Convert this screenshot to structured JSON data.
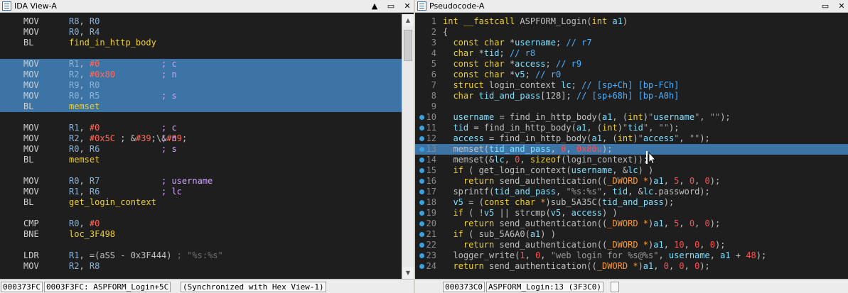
{
  "left_pane": {
    "title": "IDA View-A",
    "lines": [
      {
        "mn": "MOV",
        "op": "R8, R0",
        "cm": "",
        "hl": false
      },
      {
        "mn": "MOV",
        "op": "R0, R4",
        "cm": "",
        "hl": false
      },
      {
        "mn": "BL",
        "op": "find_in_http_body",
        "cm": "",
        "hl": false,
        "sym": true
      },
      {
        "mn": "",
        "op": "",
        "cm": "",
        "hl": false
      },
      {
        "mn": "MOV",
        "op": "R1, #0",
        "cm": "; c",
        "hl": true
      },
      {
        "mn": "MOV",
        "op": "R2, #0x80",
        "cm": "; n",
        "hl": true
      },
      {
        "mn": "MOV",
        "op": "R9, R0",
        "cm": "",
        "hl": true
      },
      {
        "mn": "MOV",
        "op": "R0, R5",
        "cm": "; s",
        "hl": true
      },
      {
        "mn": "BL",
        "op": "memset",
        "cm": "",
        "hl": true,
        "sym": true
      },
      {
        "mn": "",
        "op": "",
        "cm": "",
        "hl": false
      },
      {
        "mn": "MOV",
        "op": "R1, #0",
        "cm": "; c",
        "hl": false
      },
      {
        "mn": "MOV",
        "op": "R2, #0x5C ; '\\'",
        "cm": "; n",
        "hl": false
      },
      {
        "mn": "MOV",
        "op": "R0, R6",
        "cm": "; s",
        "hl": false
      },
      {
        "mn": "BL",
        "op": "memset",
        "cm": "",
        "hl": false,
        "sym": true
      },
      {
        "mn": "",
        "op": "",
        "cm": "",
        "hl": false
      },
      {
        "mn": "MOV",
        "op": "R0, R7",
        "cm": "; username",
        "hl": false
      },
      {
        "mn": "MOV",
        "op": "R1, R6",
        "cm": "; lc",
        "hl": false
      },
      {
        "mn": "BL",
        "op": "get_login_context",
        "cm": "",
        "hl": false,
        "sym": true
      },
      {
        "mn": "",
        "op": "",
        "cm": "",
        "hl": false
      },
      {
        "mn": "CMP",
        "op": "R0, #0",
        "cm": "",
        "hl": false
      },
      {
        "mn": "BNE",
        "op": "loc_3F498",
        "cm": "",
        "hl": false,
        "sym": true
      },
      {
        "mn": "",
        "op": "",
        "cm": "",
        "hl": false
      },
      {
        "mn": "LDR",
        "op": "R1, =(aSS - 0x3F444) ; \"%s:%s\"",
        "cm": "",
        "hl": false
      },
      {
        "mn": "MOV",
        "op": "R2, R8",
        "cm": "",
        "hl": false
      }
    ],
    "status": [
      "000373FC",
      "0003F3FC: ASPFORM_Login+5C",
      "(Synchronized with Hex View-1)"
    ]
  },
  "right_pane": {
    "title": "Pseudocode-A",
    "lines": [
      {
        "n": "1",
        "t": "int __fastcall ASPFORM_Login(int a1)",
        "dot": false
      },
      {
        "n": "2",
        "t": "{",
        "dot": false
      },
      {
        "n": "3",
        "t": "  const char *username; // r7",
        "dot": false
      },
      {
        "n": "4",
        "t": "  char *tid; // r8",
        "dot": false
      },
      {
        "n": "5",
        "t": "  const char *access; // r9",
        "dot": false
      },
      {
        "n": "6",
        "t": "  const char *v5; // r0",
        "dot": false
      },
      {
        "n": "7",
        "t": "  struct login_context lc; // [sp+Ch] [bp-FCh]",
        "dot": false
      },
      {
        "n": "8",
        "t": "  char tid_and_pass[128]; // [sp+68h] [bp-A0h]",
        "dot": false
      },
      {
        "n": "9",
        "t": "",
        "dot": false
      },
      {
        "n": "10",
        "t": "  username = find_in_http_body(a1, (int)\"username\", \"\");",
        "dot": true
      },
      {
        "n": "11",
        "t": "  tid = find_in_http_body(a1, (int)\"tid\", \"\");",
        "dot": true
      },
      {
        "n": "12",
        "t": "  access = find_in_http_body(a1, (int)\"access\", \"\");",
        "dot": true
      },
      {
        "n": "13",
        "t": "  memset(tid_and_pass, 0, 0x80u);",
        "dot": true,
        "hl": true
      },
      {
        "n": "14",
        "t": "  memset(&lc, 0, sizeof(login_context));",
        "dot": true
      },
      {
        "n": "15",
        "t": "  if ( get_login_context(username, &lc) )",
        "dot": true
      },
      {
        "n": "16",
        "t": "    return send_authentication((_DWORD *)a1, 5, 0, 0);",
        "dot": true
      },
      {
        "n": "17",
        "t": "  sprintf(tid_and_pass, \"%s:%s\", tid, &lc.password);",
        "dot": true
      },
      {
        "n": "18",
        "t": "  v5 = (const char *)sub_5A35C(tid_and_pass);",
        "dot": true
      },
      {
        "n": "19",
        "t": "  if ( !v5 || strcmp(v5, access) )",
        "dot": true
      },
      {
        "n": "20",
        "t": "    return send_authentication((_DWORD *)a1, 5, 0, 0);",
        "dot": true
      },
      {
        "n": "21",
        "t": "  if ( sub_5A6A0(a1) )",
        "dot": true
      },
      {
        "n": "22",
        "t": "    return send_authentication((_DWORD *)a1, 10, 0, 0);",
        "dot": true
      },
      {
        "n": "23",
        "t": "  logger_write(1, 0, \"web login for %s@%s\", username, a1 + 48);",
        "dot": true
      },
      {
        "n": "24",
        "t": "  return send_authentication((_DWORD *)a1, 0, 0, 0);",
        "dot": true
      }
    ],
    "status": [
      "000373C0",
      "ASPFORM_Login:13 (3F3C0)",
      ""
    ]
  },
  "window_buttons": {
    "pin": "▲",
    "float": "▭",
    "close": "✕"
  },
  "scroll": {
    "up": "▲",
    "down": "▼"
  },
  "icons": {
    "view_icon": "listing-icon",
    "cursor": "mouse-cursor-icon"
  },
  "colors": {
    "background": "#1e1e1e",
    "highlight": "#3c74a6",
    "bullet": "#3aa0e0",
    "symbol": "#f0d030"
  }
}
